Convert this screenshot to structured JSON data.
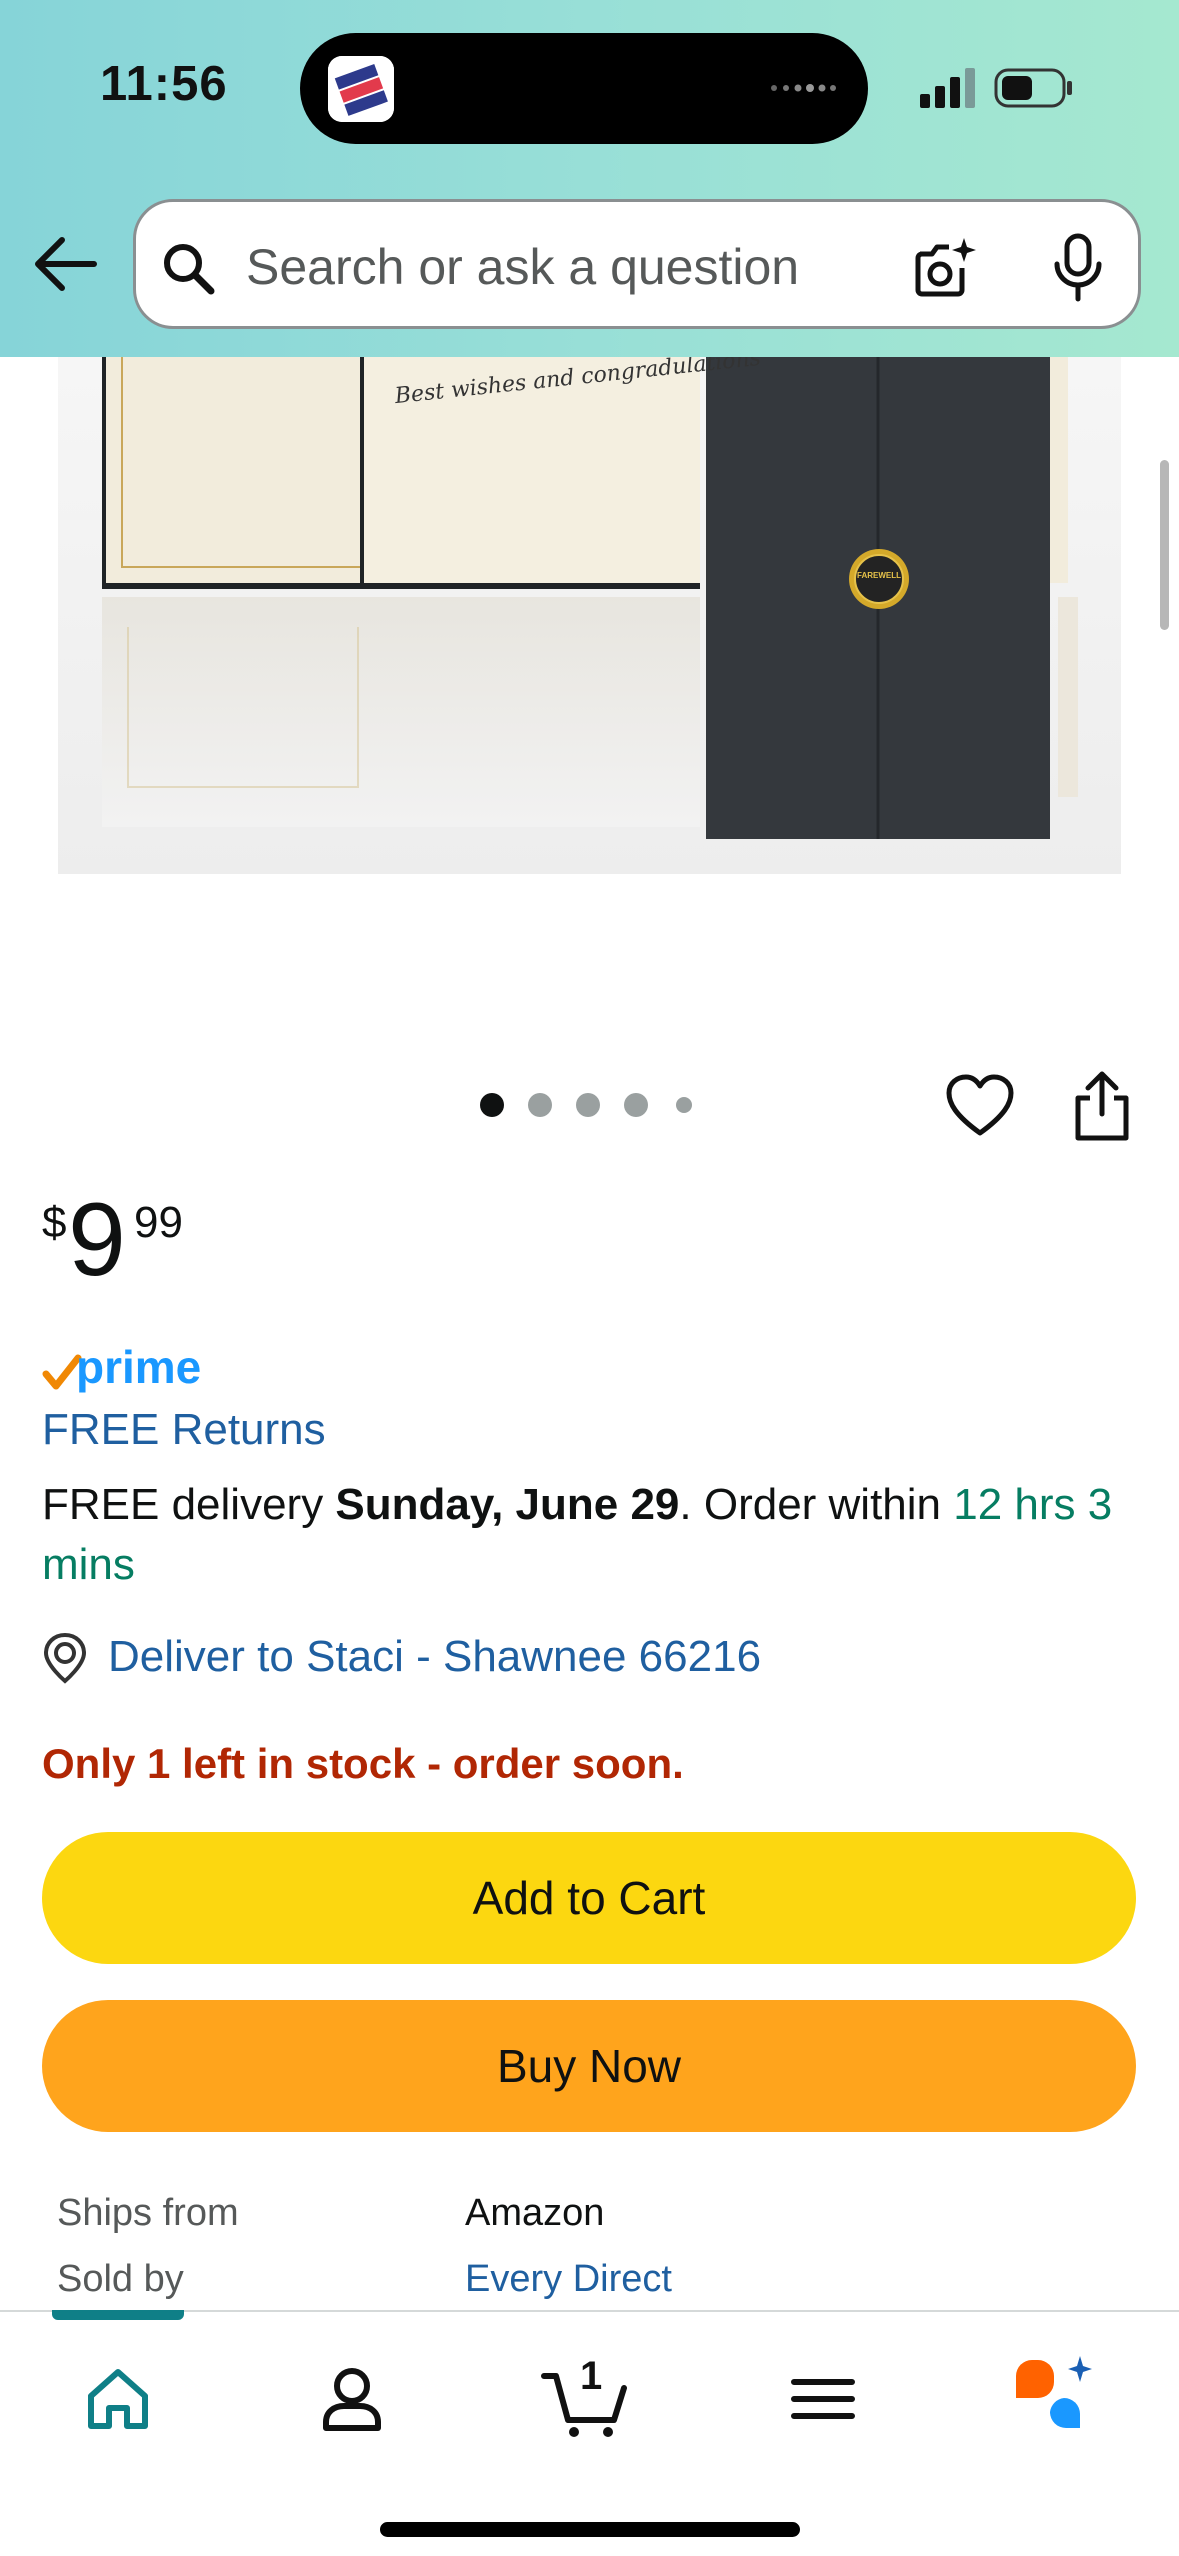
{
  "status_bar": {
    "time": "11:56",
    "island_app_icon": "the-base-yard-app-icon",
    "signal_icon": "cellular-signal-icon",
    "battery_icon": "battery-icon"
  },
  "header": {
    "back_icon": "arrow-left-icon",
    "search": {
      "placeholder": "Search or ask a question",
      "value": ""
    },
    "camera_icon": "camera-sparkle-icon",
    "mic_icon": "microphone-icon"
  },
  "product_image": {
    "handwriting": "Best wishes and congradulations",
    "seal_text": "FAREWELL",
    "carousel_total": 5,
    "carousel_active": 1
  },
  "actions": {
    "heart_icon": "heart-outline-icon",
    "share_icon": "share-icon"
  },
  "price": {
    "symbol": "$",
    "whole": "9",
    "fraction": "99"
  },
  "prime": {
    "logo_text": "prime",
    "check_color": "#f08804",
    "text_color": "#1a98ff"
  },
  "free_returns": "FREE Returns",
  "delivery": {
    "prefix": "FREE delivery ",
    "date": "Sunday, June 29",
    "middle": ". Order within ",
    "countdown": "12 hrs 3 mins"
  },
  "deliver_to": {
    "icon": "location-pin-icon",
    "text": "Deliver to Staci - Shawnee 66216"
  },
  "stock": "Only 1 left in stock - order soon.",
  "buttons": {
    "add_to_cart": "Add to Cart",
    "buy_now": "Buy Now"
  },
  "seller_info": [
    {
      "label": "Ships from",
      "value": "Amazon"
    },
    {
      "label": "Sold by",
      "value": "Every Direct"
    }
  ],
  "bottom_nav": {
    "items": [
      {
        "icon": "home-icon",
        "active": true
      },
      {
        "icon": "account-icon",
        "active": false
      },
      {
        "icon": "cart-icon",
        "badge": "1",
        "active": false
      },
      {
        "icon": "menu-icon",
        "active": false
      },
      {
        "icon": "rufus-assistant-icon",
        "active": false
      }
    ]
  },
  "colors": {
    "link": "#1f5fa0",
    "deal_red": "#b12704",
    "green": "#067d62",
    "add_to_cart": "#fcd710",
    "buy_now": "#ffa41c",
    "nav_active": "#0f7f87"
  }
}
